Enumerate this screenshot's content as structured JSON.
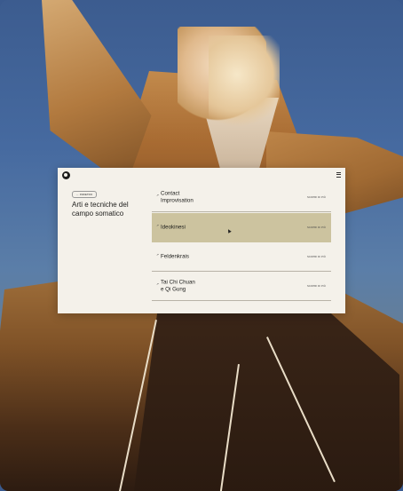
{
  "window": {
    "back_label": "← INDIETRO",
    "title": "Arti e tecniche del campo somatico"
  },
  "list": {
    "items": [
      {
        "label": "Contact\nImprovisation",
        "action": "SCOPRI DI PIÙ",
        "active": false
      },
      {
        "label": "Ideokinesi",
        "action": "SCOPRI DI PIÙ",
        "active": true
      },
      {
        "label": "Feldenkrais",
        "action": "SCOPRI DI PIÙ",
        "active": false
      },
      {
        "label": "Tai Chi Chuan\ne Qi Gung",
        "action": "SCOPRI DI PIÙ",
        "active": false
      }
    ],
    "arrow_glyph": "↗"
  },
  "icons": {
    "logo": "logo-icon",
    "menu": "menu-icon",
    "cursor": "cursor-icon"
  },
  "colors": {
    "panel_bg": "#f4f1ea",
    "active_row": "#ccc39f",
    "text": "#1d1d1b"
  }
}
